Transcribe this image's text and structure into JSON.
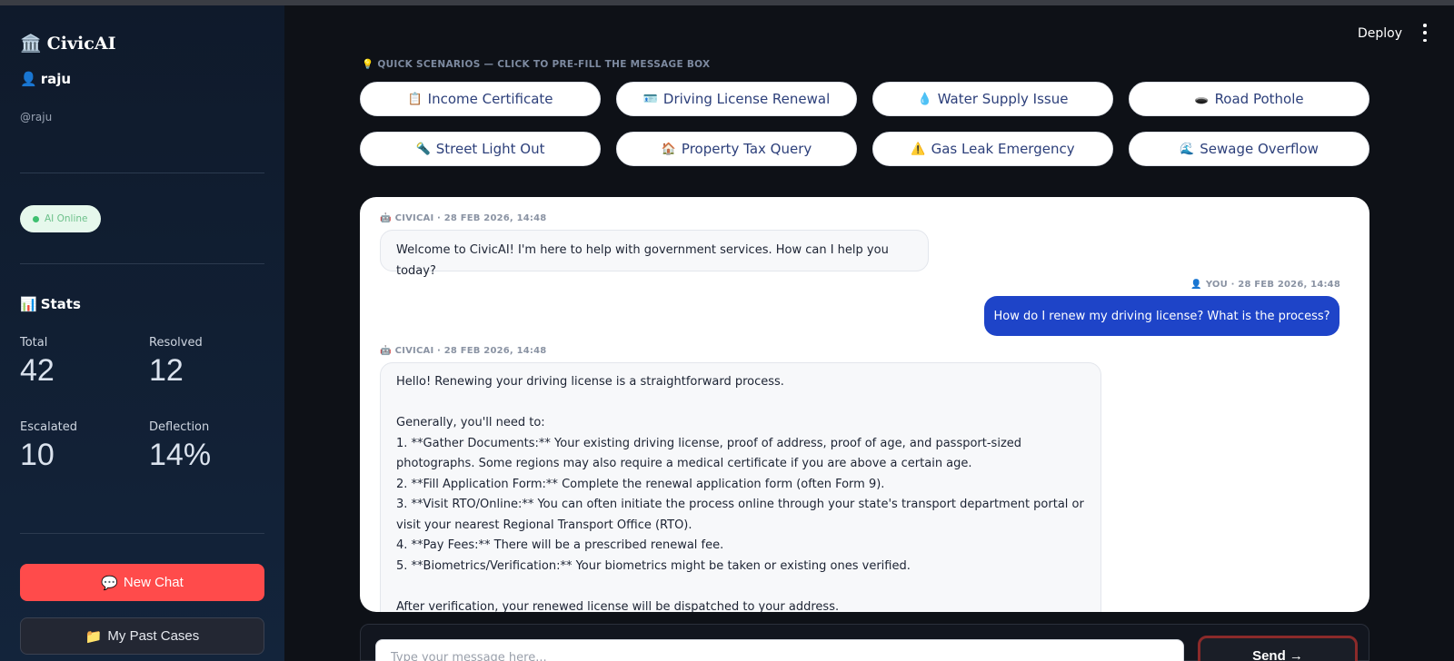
{
  "sidebar": {
    "brand_icon": "🏛️",
    "brand": "CivicAI",
    "user_icon": "👤",
    "username": "raju",
    "handle": "@raju",
    "status": "AI Online",
    "stats_icon": "📊",
    "stats_title": "Stats",
    "stats": [
      {
        "label": "Total",
        "value": "42"
      },
      {
        "label": "Resolved",
        "value": "12"
      },
      {
        "label": "Escalated",
        "value": "10"
      },
      {
        "label": "Deflection",
        "value": "14%"
      }
    ],
    "new_chat_icon": "💬",
    "new_chat": "New Chat",
    "past_cases_icon": "📁",
    "past_cases": "My Past Cases"
  },
  "header": {
    "deploy": "Deploy"
  },
  "scenarios": {
    "title_icon": "💡",
    "title": "QUICK SCENARIOS — CLICK TO PRE-FILL THE MESSAGE BOX",
    "items": [
      {
        "icon": "📋",
        "label": "Income Certificate"
      },
      {
        "icon": "🪪",
        "label": "Driving License Renewal"
      },
      {
        "icon": "💧",
        "label": "Water Supply Issue"
      },
      {
        "icon": "🕳️",
        "label": "Road Pothole"
      },
      {
        "icon": "🔦",
        "label": "Street Light Out"
      },
      {
        "icon": "🏠",
        "label": "Property Tax Query"
      },
      {
        "icon": "⚠️",
        "label": "Gas Leak Emergency"
      },
      {
        "icon": "🌊",
        "label": "Sewage Overflow"
      }
    ]
  },
  "chat": {
    "messages": [
      {
        "meta_icon": "🤖",
        "meta": "CIVICAI · 28 FEB 2026, 14:48",
        "text": "Welcome to CivicAI! I'm here to help with government services. How can I help you today?"
      },
      {
        "meta_icon": "👤",
        "meta": "YOU · 28 FEB 2026, 14:48",
        "text": "How do I renew my driving license? What is the process?"
      },
      {
        "meta_icon": "🤖",
        "meta": "CIVICAI · 28 FEB 2026, 14:48",
        "text": "Hello! Renewing your driving license is a straightforward process.\n\nGenerally, you'll need to:\n1. **Gather Documents:** Your existing driving license, proof of address, proof of age, and passport-sized photographs. Some regions may also require a medical certificate if you are above a certain age.\n2. **Fill Application Form:** Complete the renewal application form (often Form 9).\n3. **Visit RTO/Online:** You can often initiate the process online through your state's transport department portal or visit your nearest Regional Transport Office (RTO).\n4. **Pay Fees:** There will be a prescribed renewal fee.\n5. **Biometrics/Verification:** Your biometrics might be taken or existing ones verified.\n\nAfter verification, your renewed license will be dispatched to your address."
      }
    ]
  },
  "input": {
    "placeholder": "Type your message here...",
    "send": "Send →"
  }
}
